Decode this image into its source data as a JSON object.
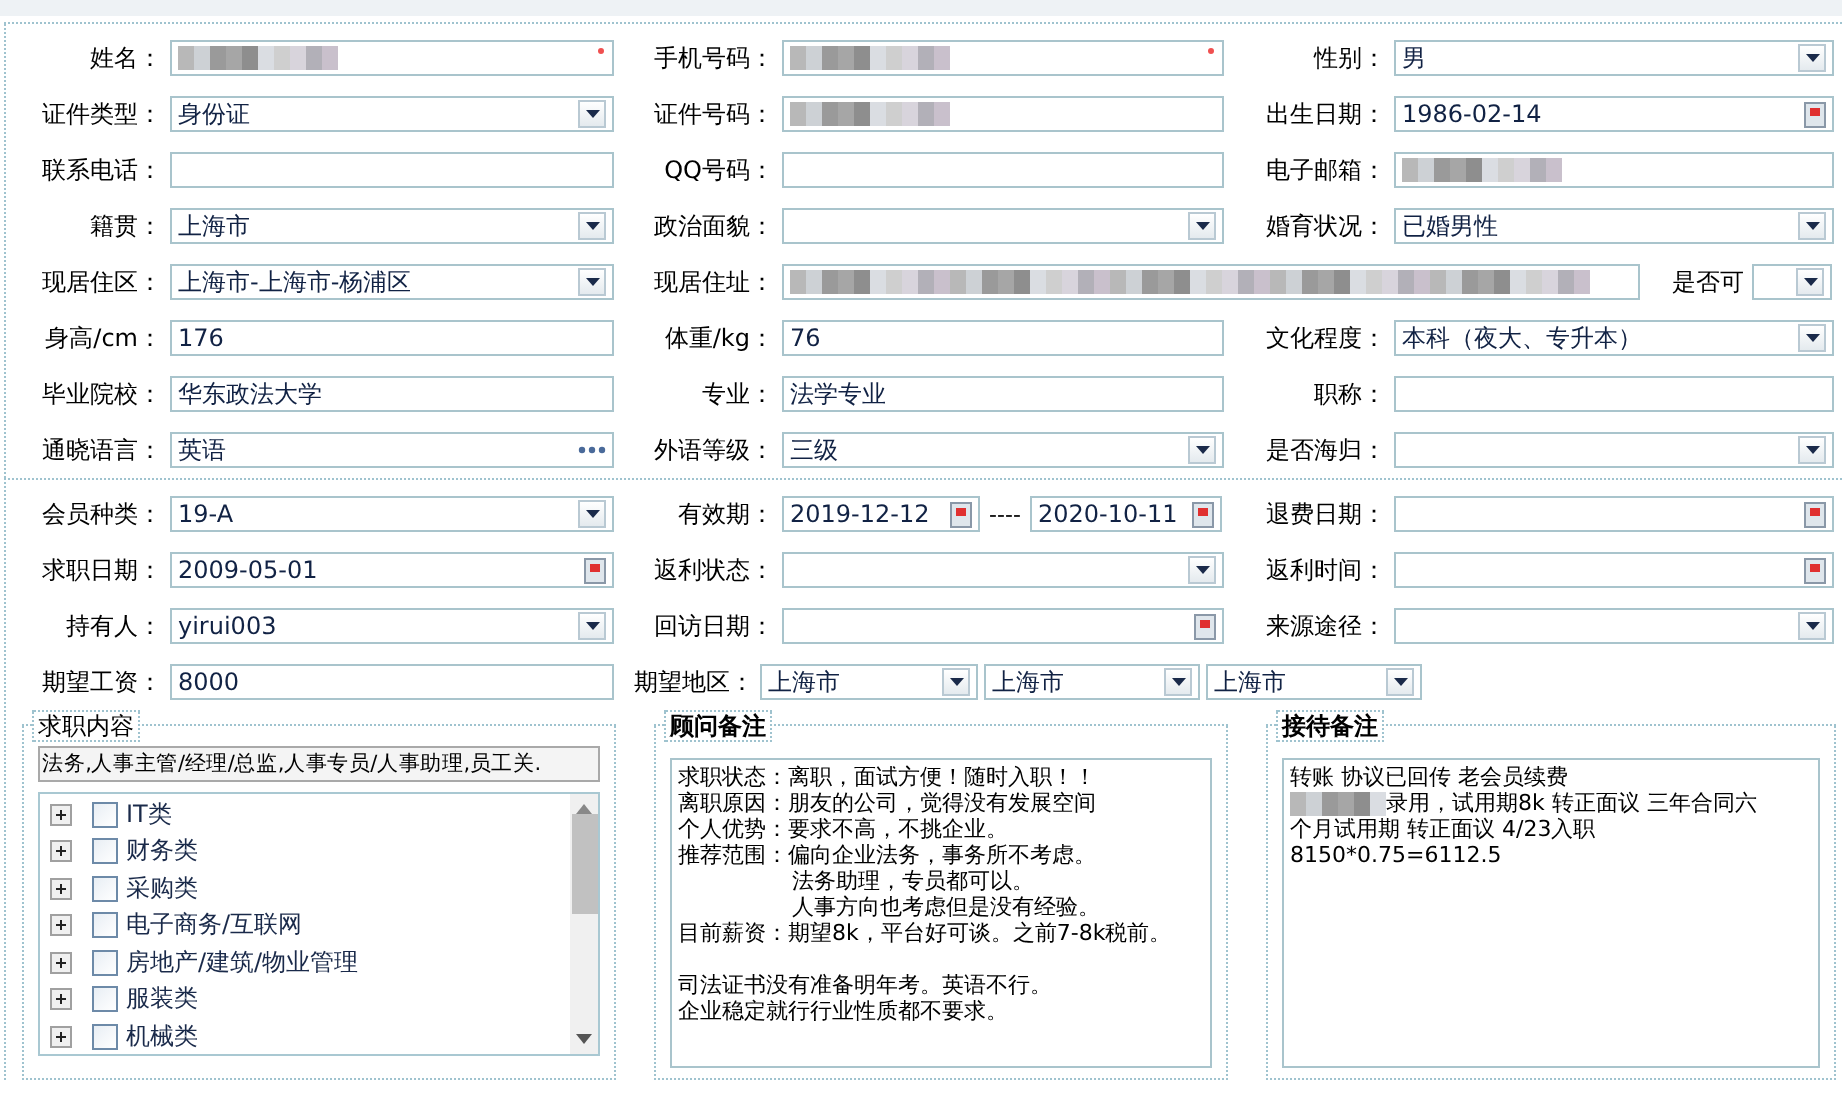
{
  "sections": [
    {
      "rows": [
        {
          "cells": [
            {
              "label": "姓名：",
              "kind": "redacted",
              "required": true
            },
            {
              "label": "手机号码：",
              "kind": "redacted",
              "required": true
            },
            {
              "label": "性别：",
              "kind": "select",
              "value": "男",
              "required": false
            }
          ]
        },
        {
          "cells": [
            {
              "label": "证件类型：",
              "kind": "select",
              "value": "身份证",
              "required": false
            },
            {
              "label": "证件号码：",
              "kind": "redacted",
              "required": false
            },
            {
              "label": "出生日期：",
              "kind": "date",
              "value": "1986-02-14",
              "required": false
            }
          ]
        },
        {
          "cells": [
            {
              "label": "联系电话：",
              "kind": "text",
              "required": false
            },
            {
              "label": "QQ号码：",
              "kind": "text",
              "required": false
            },
            {
              "label": "电子邮箱：",
              "kind": "redacted",
              "required": false
            }
          ]
        },
        {
          "cells": [
            {
              "label": "籍贯：",
              "kind": "select",
              "value": "上海市",
              "required": false
            },
            {
              "label": "政治面貌：",
              "kind": "select",
              "required": false
            },
            {
              "label": "婚育状况：",
              "kind": "select",
              "value": "已婚男性",
              "required": false
            }
          ]
        },
        {
          "cells": [
            {
              "label": "现居住区：",
              "kind": "select",
              "value": "上海市-上海市-杨浦区",
              "required": false
            },
            {
              "label": "现居住址：",
              "kind": "address",
              "required": false
            },
            {
              "label": "是否可",
              "kind": "select",
              "required": false
            }
          ]
        },
        {
          "cells": [
            {
              "label": "身高/cm：",
              "kind": "text",
              "value": "176",
              "required": false
            },
            {
              "label": "体重/kg：",
              "kind": "text",
              "value": "76",
              "required": false
            },
            {
              "label": "文化程度：",
              "kind": "select",
              "value": "本科（夜大、专升本）",
              "required": false
            }
          ]
        },
        {
          "cells": [
            {
              "label": "毕业院校：",
              "kind": "text",
              "value": "华东政法大学",
              "required": false
            },
            {
              "label": "专业：",
              "kind": "text",
              "value": "法学专业",
              "required": false
            },
            {
              "label": "职称：",
              "kind": "text",
              "required": false
            }
          ]
        },
        {
          "cells": [
            {
              "label": "通晓语言：",
              "kind": "more",
              "value": "英语",
              "required": false
            },
            {
              "label": "外语等级：",
              "kind": "select",
              "value": "三级",
              "required": false
            },
            {
              "label": "是否海归：",
              "kind": "select",
              "required": false
            }
          ]
        }
      ]
    },
    {
      "rows": [
        {
          "cells": [
            {
              "label": "会员种类：",
              "kind": "select",
              "value": "19-A",
              "required": false
            },
            {
              "label": "有效期：",
              "kind": "daterange",
              "values": [
                "2019-12-12",
                "2020-10-11"
              ],
              "separator": "----",
              "required": false
            },
            {
              "label": "退费日期：",
              "kind": "date",
              "required": false
            }
          ]
        },
        {
          "cells": [
            {
              "label": "求职日期：",
              "kind": "date",
              "value": "2009-05-01",
              "required": false
            },
            {
              "label": "返利状态：",
              "kind": "select",
              "required": false
            },
            {
              "label": "返利时间：",
              "kind": "date",
              "required": false
            }
          ]
        },
        {
          "cells": [
            {
              "label": "持有人：",
              "kind": "select",
              "value": "yirui003",
              "required": false
            },
            {
              "label": "回访日期：",
              "kind": "date",
              "required": false
            },
            {
              "label": "来源途径：",
              "kind": "select",
              "required": false
            }
          ]
        },
        {
          "cells": [
            {
              "label": "期望工资：",
              "kind": "text",
              "value": "8000",
              "required": false
            },
            {
              "label": "期望地区：",
              "kind": "multiselect",
              "values": [
                "上海市",
                "上海市",
                "上海市"
              ],
              "required": false
            }
          ]
        }
      ]
    }
  ],
  "job_content": {
    "title": "求职内容",
    "selection": "法务,人事主管/经理/总监,人事专员/人事助理,员工关.",
    "items": [
      {
        "label": "IT类",
        "checked": false,
        "expanded": false
      },
      {
        "label": "财务类",
        "checked": false,
        "expanded": false
      },
      {
        "label": "采购类",
        "checked": false,
        "expanded": false
      },
      {
        "label": "电子商务/互联网",
        "checked": false,
        "expanded": false
      },
      {
        "label": "房地产/建筑/物业管理",
        "checked": false,
        "expanded": false
      },
      {
        "label": "服装类",
        "checked": false,
        "expanded": false
      },
      {
        "label": "机械类",
        "checked": false,
        "expanded": false
      }
    ]
  },
  "advisor_notes": {
    "title": "顾问备注",
    "lines": [
      {
        "kind": "text",
        "text": "求职状态：离职，面试方便！随时入职！！"
      },
      {
        "kind": "text",
        "text": "离职原因：朋友的公司，觉得没有发展空间"
      },
      {
        "kind": "text",
        "text": "个人优势：要求不高，不挑企业。"
      },
      {
        "kind": "text",
        "text": "推荐范围：偏向企业法务，事务所不考虑。"
      },
      {
        "kind": "indent",
        "text": "法务助理，专员都可以。"
      },
      {
        "kind": "indent",
        "text": "人事方向也考虑但是没有经验。"
      },
      {
        "kind": "text",
        "text": "目前薪资：期望8k，平台好可谈。之前7-8k税前。"
      },
      {
        "kind": "blank"
      },
      {
        "kind": "text",
        "text": "司法证书没有准备明年考。英语不行。"
      },
      {
        "kind": "text",
        "text": "企业稳定就行行业性质都不要求。"
      }
    ]
  },
  "reception_notes": {
    "title": "接待备注",
    "lines": [
      {
        "kind": "text",
        "text": "转账 协议已回传 老会员续费"
      },
      {
        "kind": "blurred",
        "text": "录用，试用期8k 转正面议 三年合同六"
      },
      {
        "kind": "text",
        "text": "个月试用期 转正面议 4/23入职"
      },
      {
        "kind": "text",
        "text": "8150*0.75=6112.5"
      }
    ]
  }
}
